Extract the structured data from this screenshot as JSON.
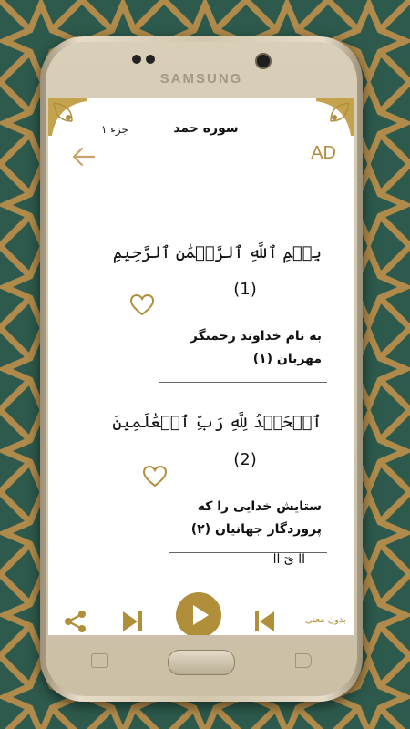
{
  "device": {
    "brand": "SAMSUNG"
  },
  "header": {
    "chapter_title": "سوره حمد",
    "juz_label": "جزء ۱",
    "ad_label": "AD"
  },
  "verses": [
    {
      "arabic": "بِسۡمِ ٱللَّهِ ٱلرَّحۡمَٰنِ ٱلرَّحِيمِ",
      "number": "(1)",
      "translation_line1": "به نام خداوند رحمتگر",
      "translation_line2": "مهربان (۱)"
    },
    {
      "arabic": "ٱلۡحَمۡدُ لِلَّهِ رَبِّ ٱلۡعَٰلَمِينَ",
      "number": "(2)",
      "translation_line1": "ستایش خدایی را که",
      "translation_line2": "پروردگار جهانیان (۲)"
    }
  ],
  "partial_verse_text": "اا    ىٓ   اا",
  "controls": {
    "no_meaning_label": "بدون معنی"
  },
  "colors": {
    "accent": "#b08e3a",
    "background": "#2d5a4c",
    "pattern": "#b08a4a"
  }
}
